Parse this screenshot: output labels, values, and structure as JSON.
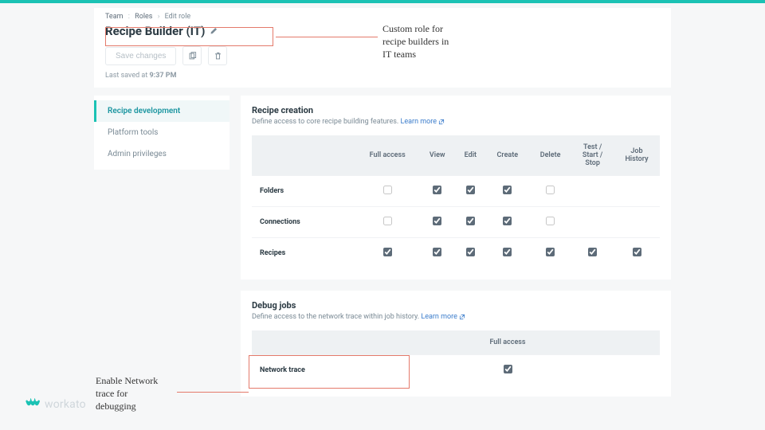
{
  "breadcrumb": {
    "a": "Team",
    "b": "Roles",
    "current": "Edit role"
  },
  "role_title": "Recipe Builder (IT)",
  "actions": {
    "save": "Save changes"
  },
  "last_saved": {
    "prefix": "Last saved at ",
    "time": "9:37 PM"
  },
  "sidebar": {
    "items": [
      {
        "label": "Recipe development",
        "active": true
      },
      {
        "label": "Platform tools",
        "active": false
      },
      {
        "label": "Admin privileges",
        "active": false
      }
    ]
  },
  "recipe_panel": {
    "title": "Recipe creation",
    "desc": "Define access to core recipe building features. ",
    "learn_more": "Learn more",
    "columns": [
      "",
      "Full access",
      "View",
      "Edit",
      "Create",
      "Delete",
      "Test /\nStart /\nStop",
      "Job\nHistory"
    ],
    "rows": [
      {
        "label": "Folders",
        "cells": [
          false,
          true,
          true,
          true,
          false,
          null,
          null
        ]
      },
      {
        "label": "Connections",
        "cells": [
          false,
          true,
          true,
          true,
          false,
          null,
          null
        ]
      },
      {
        "label": "Recipes",
        "cells": [
          true,
          true,
          true,
          true,
          true,
          true,
          true
        ]
      }
    ]
  },
  "debug_panel": {
    "title": "Debug jobs",
    "desc": "Define access to the network trace within job history. ",
    "learn_more": "Learn more",
    "columns": [
      "",
      "Full access"
    ],
    "rows": [
      {
        "label": "Network trace",
        "cells": [
          true
        ]
      }
    ]
  },
  "annotations": {
    "title": "Custom role for\nrecipe builders in\nIT teams",
    "debug": "Enable Network\ntrace for\ndebugging"
  },
  "logo_text": "workato"
}
